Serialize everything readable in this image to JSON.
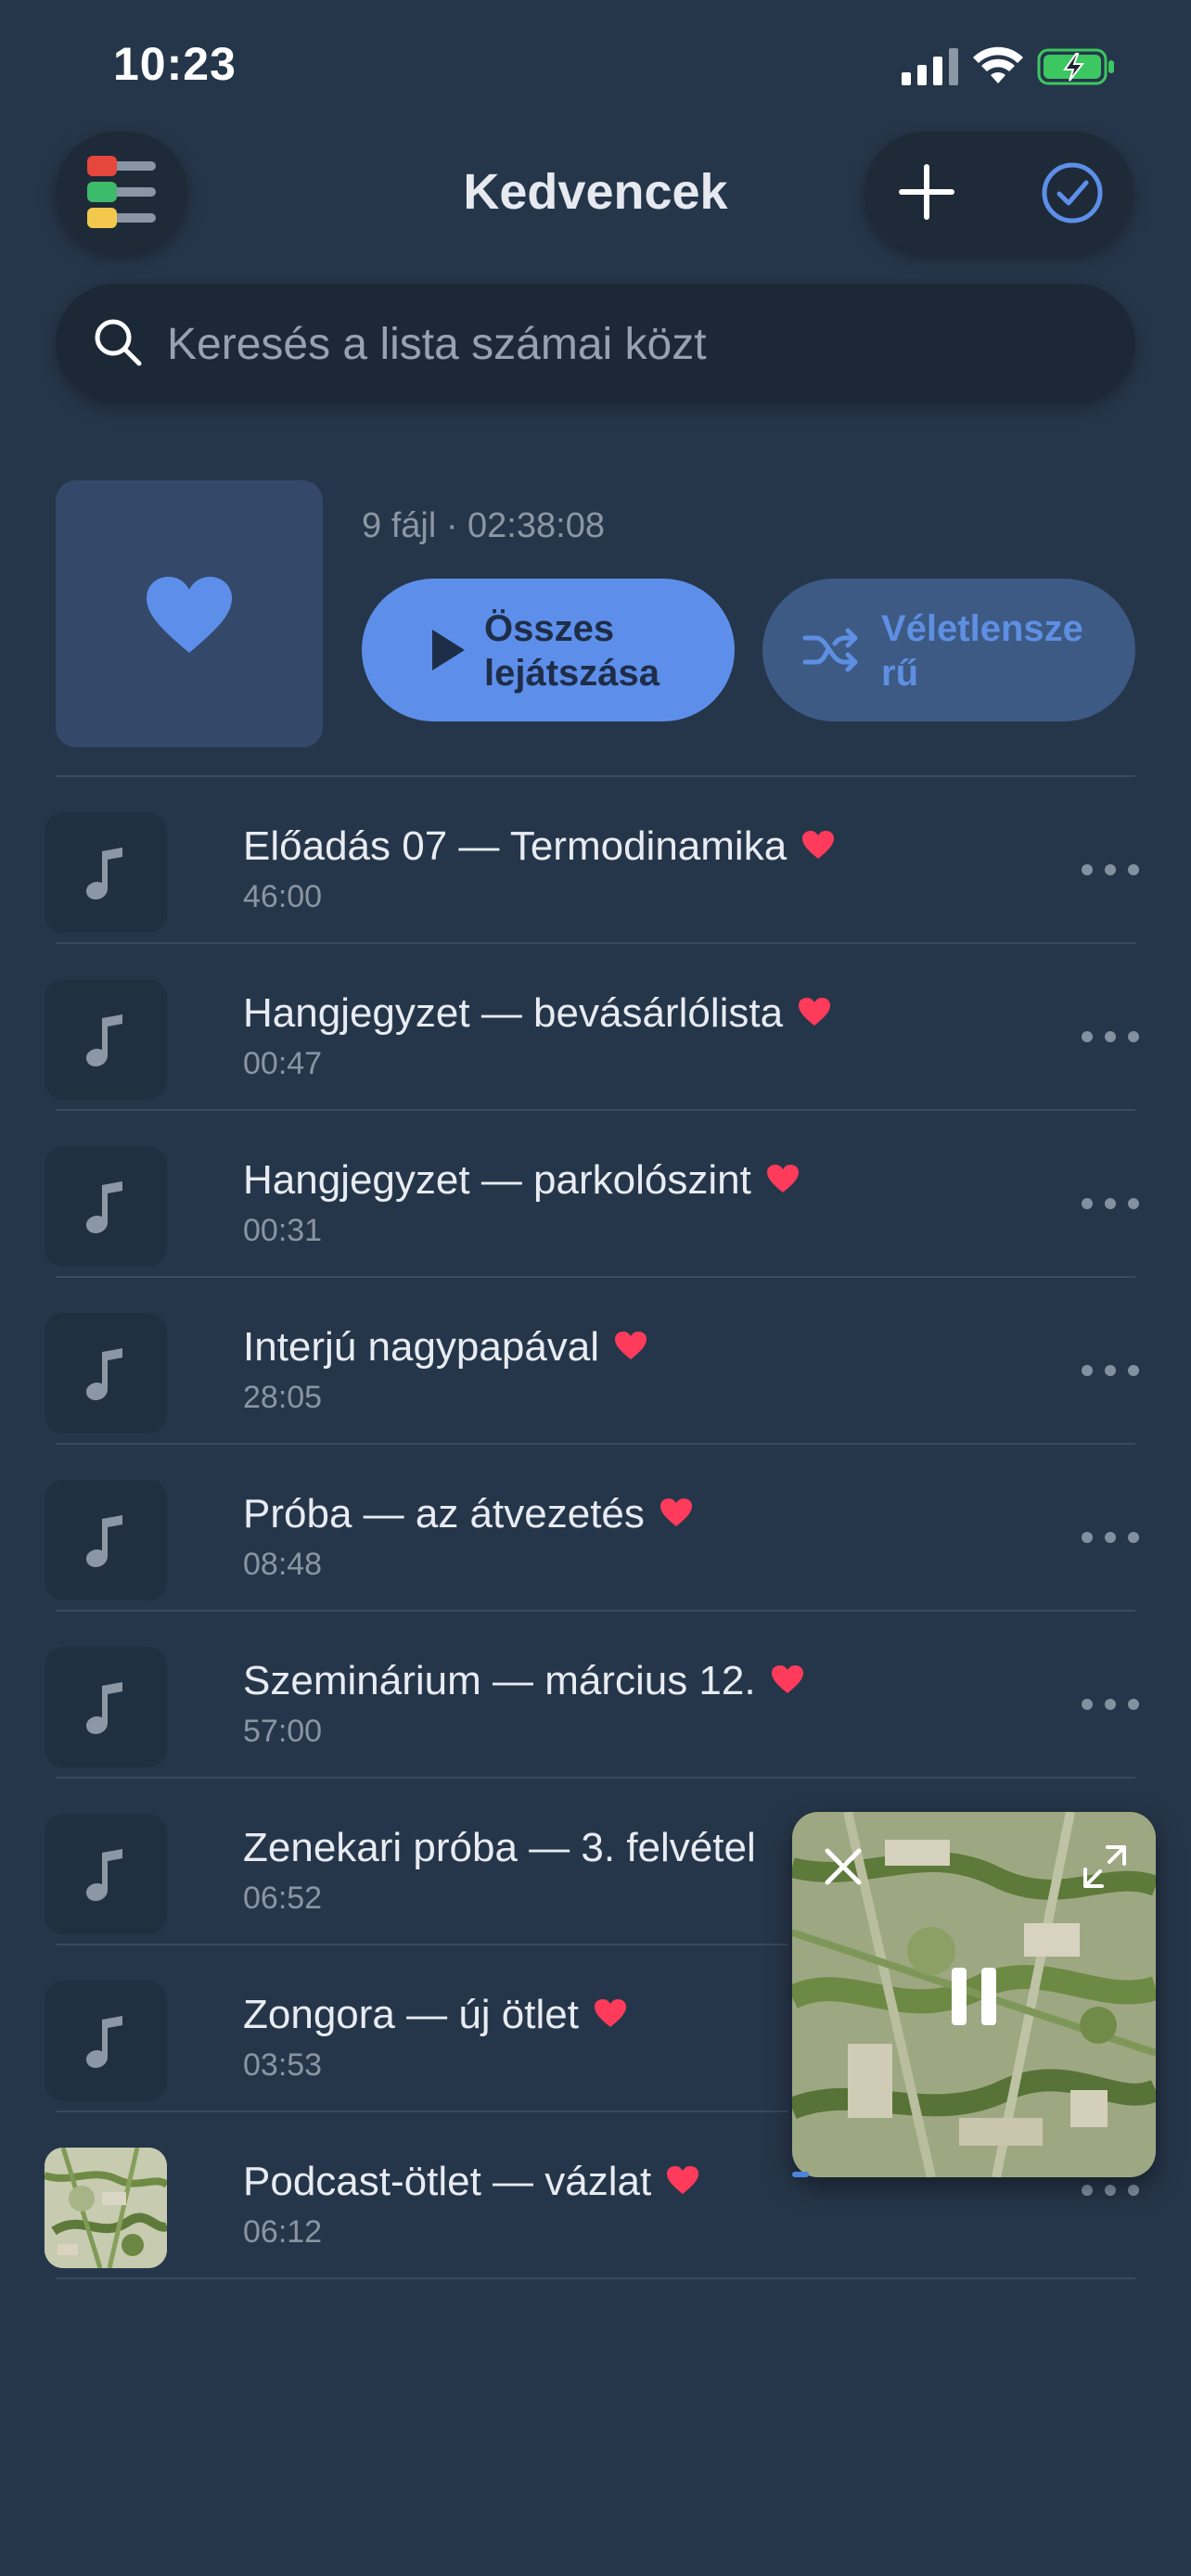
{
  "status_bar": {
    "time": "10:23"
  },
  "header": {
    "title": "Kedvencek"
  },
  "search": {
    "placeholder": "Keresés a lista számai közt"
  },
  "playlist": {
    "meta": "9 fájl · 02:38:08",
    "play_all_label_line1": "Összes",
    "play_all_label_line2": "lejátszása",
    "shuffle_label_line1": "Véletlensze",
    "shuffle_label_line2": "rű"
  },
  "tracks": [
    {
      "title": "Előadás 07 — Termodinamika",
      "duration": "46:00",
      "favorite": true
    },
    {
      "title": "Hangjegyzet — bevásárlólista",
      "duration": "00:47",
      "favorite": true
    },
    {
      "title": "Hangjegyzet — parkolószint",
      "duration": "00:31",
      "favorite": true
    },
    {
      "title": "Interjú nagypapával",
      "duration": "28:05",
      "favorite": true
    },
    {
      "title": "Próba — az átvezetés",
      "duration": "08:48",
      "favorite": true
    },
    {
      "title": "Szeminárium — március 12.",
      "duration": "57:00",
      "favorite": true
    },
    {
      "title": "Zenekari próba — 3. felvétel",
      "duration": "06:52",
      "favorite": false
    },
    {
      "title": "Zongora — új ötlet",
      "duration": "03:53",
      "favorite": true
    },
    {
      "title": "Podcast-ötlet — vázlat",
      "duration": "06:12",
      "favorite": true
    }
  ],
  "mini_player": {
    "state": "playing",
    "progress": 0.05
  },
  "colors": {
    "background": "#26364A",
    "accent": "#5D8FEA",
    "heart": "#FF3B5C",
    "menu_red": "#E5473C",
    "menu_green": "#3DBA6A",
    "menu_yellow": "#F2C94C"
  },
  "icons": [
    "menu-icon",
    "plus-icon",
    "check-circle-icon",
    "search-icon",
    "heart-icon",
    "play-icon",
    "shuffle-icon",
    "music-note-icon",
    "more-icon",
    "close-icon",
    "expand-icon",
    "pause-icon"
  ]
}
